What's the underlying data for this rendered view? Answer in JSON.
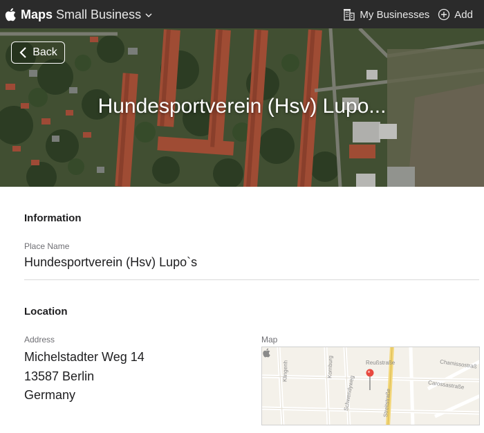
{
  "header": {
    "brand_bold": "Maps",
    "brand_sub": "Small Business",
    "my_businesses": "My Businesses",
    "add": "Add"
  },
  "hero": {
    "back_label": "Back",
    "title": "Hundesportverein (Hsv) Lupo..."
  },
  "information": {
    "heading": "Information",
    "place_name_label": "Place Name",
    "place_name": "Hundesportverein (Hsv) Lupo`s"
  },
  "location": {
    "heading": "Location",
    "address_label": "Address",
    "address_lines": [
      "Michelstadter Weg 14",
      "13587 Berlin",
      "Germany"
    ],
    "map_label": "Map"
  },
  "map": {
    "streets": [
      "Klingenh",
      "Kornburg",
      "Reußstraße",
      "Chamissostraß",
      "Schwendyweg",
      "Carossastraße",
      "Streitstraße"
    ],
    "pin_color": "#e8493f"
  },
  "icons": {
    "logo": "apple-logo-icon",
    "dropdown": "chevron-down-icon",
    "businesses": "building-icon",
    "add": "plus-circle-icon",
    "back": "chevron-left-icon",
    "pin": "map-pin-icon"
  }
}
